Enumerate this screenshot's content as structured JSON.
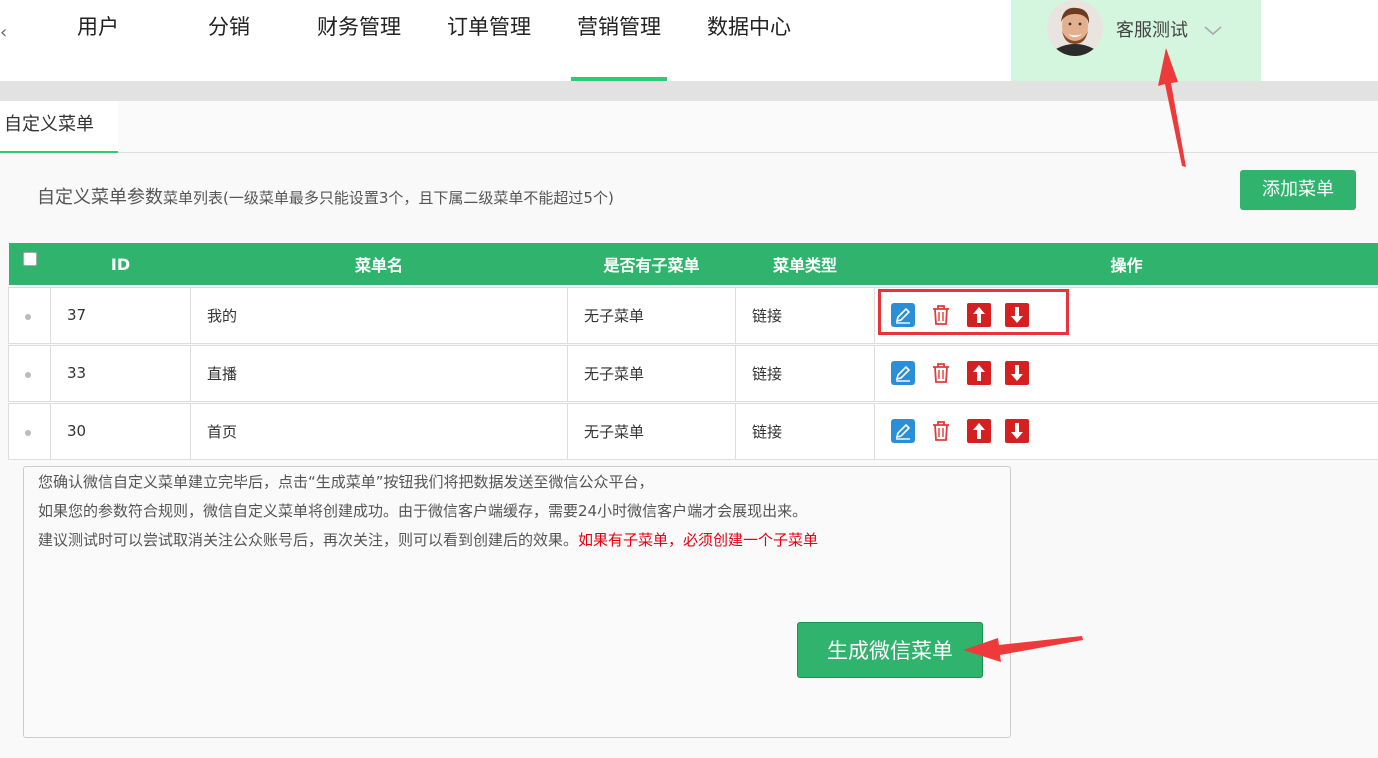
{
  "nav": {
    "items": [
      {
        "label": "用户"
      },
      {
        "label": "分销"
      },
      {
        "label": "财务管理"
      },
      {
        "label": "订单管理"
      },
      {
        "label": "营销管理"
      },
      {
        "label": "数据中心"
      }
    ],
    "active_index": 4,
    "user": {
      "name": "客服测试",
      "avatar": "avatar-photo"
    }
  },
  "tabs": [
    {
      "label": "自定义菜单"
    }
  ],
  "params": {
    "title": "自定义菜单参数",
    "subtitle": "菜单列表(一级菜单最多只能设置3个，且下属二级菜单不能超过5个)"
  },
  "toolbar": {
    "add_label": "添加菜单"
  },
  "table": {
    "headers": [
      "",
      "ID",
      "菜单名",
      "是否有子菜单",
      "菜单类型",
      "操作"
    ],
    "rows": [
      {
        "id": "37",
        "name": "我的",
        "has_sub": "无子菜单",
        "type": "链接"
      },
      {
        "id": "33",
        "name": "直播",
        "has_sub": "无子菜单",
        "type": "链接"
      },
      {
        "id": "30",
        "name": "首页",
        "has_sub": "无子菜单",
        "type": "链接"
      }
    ],
    "op_icons": [
      "edit-icon",
      "delete-icon",
      "move-up-icon",
      "move-down-icon"
    ]
  },
  "notice": {
    "line1": "您确认微信自定义菜单建立完毕后，点击“生成菜单”按钮我们将把数据发送至微信公众平台，",
    "line2": "如果您的参数符合规则，微信自定义菜单将创建成功。由于微信客户端缓存，需要24小时微信客户端才会展现出来。",
    "line3": "建议测试时可以尝试取消关注公众账号后，再次关注，则可以看到创建后的效果。",
    "warning": "如果有子菜单，必须创建一个子菜单"
  },
  "generate_label": "生成微信菜单",
  "colors": {
    "accent": "#2fb36d",
    "warning": "#e60012",
    "annotation": "#e8323c"
  }
}
